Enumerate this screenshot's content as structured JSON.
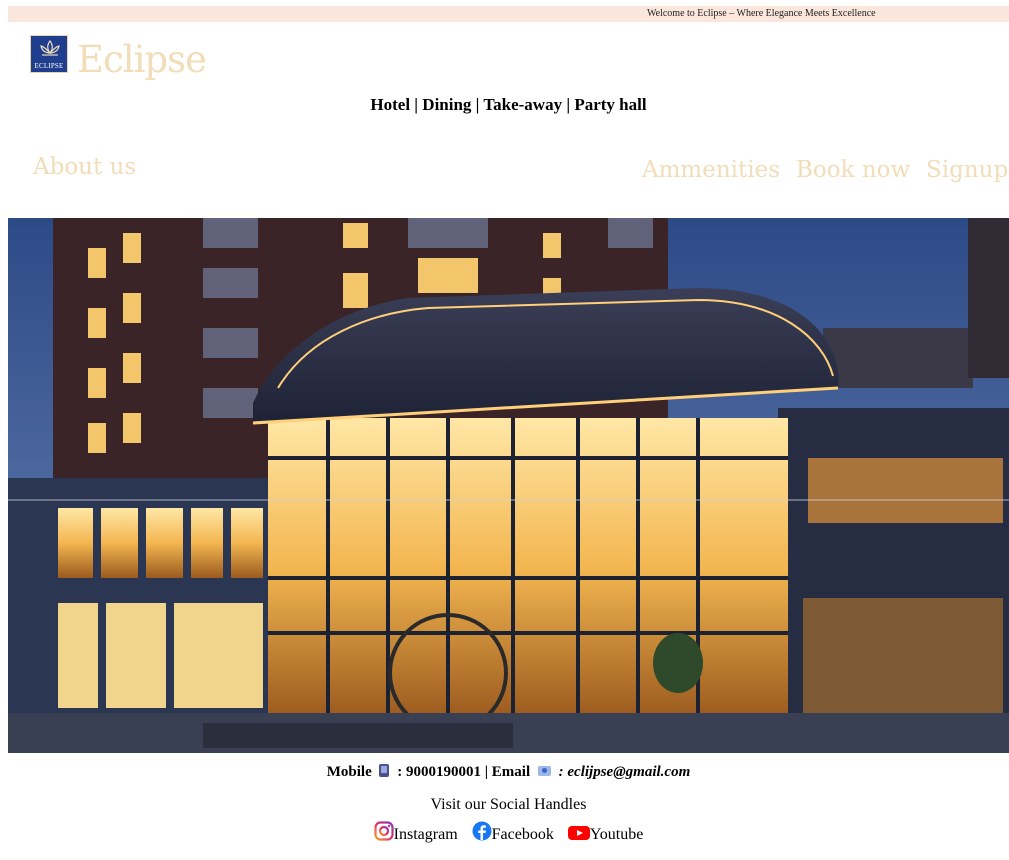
{
  "topbar": {
    "welcome": "Welcome to Eclipse – Where Elegance Meets Excellence"
  },
  "brand": {
    "badge_text": "ECLIPSE",
    "name": "Eclipse"
  },
  "services": "Hotel | Dining | Take-away | Party hall",
  "nav": {
    "about": "About us",
    "amenities": "Ammenities",
    "book": "Book now",
    "signup": "Signup"
  },
  "contact": {
    "mobile_label": "Mobile",
    "mobile_value": ": 9000190001",
    "separator": "|",
    "email_label": "Email",
    "email_value": ": eclijpse@gmail.com",
    "phone_icon": "mobile-phone-icon",
    "email_icon": "email-icon"
  },
  "social": {
    "title": "Visit our Social Handles",
    "links": [
      {
        "label": "Instagram",
        "icon": "instagram-icon"
      },
      {
        "label": "Facebook",
        "icon": "facebook-icon"
      },
      {
        "label": "Youtube",
        "icon": "youtube-icon"
      }
    ]
  },
  "colors": {
    "topbar_bg": "#fbe6dc",
    "brand_gold": "#f1ddb8",
    "badge_blue": "#1f3e8e"
  }
}
